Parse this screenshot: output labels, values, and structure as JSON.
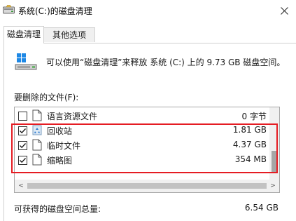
{
  "window": {
    "title": "系统(C:)的磁盘清理",
    "close_glyph": "✕"
  },
  "tabs": [
    {
      "label": "磁盘清理",
      "active": true
    },
    {
      "label": "其他选项",
      "active": false
    }
  ],
  "drive_description": "可以使用“磁盘清理”来释放 系统 (C:) 上的 9.73 GB 磁盘空间。",
  "files_to_delete_label": "要删除的文件(F):",
  "file_list": [
    {
      "name": "语言资源文件",
      "size": "0 字节",
      "checked": false,
      "icon": "file-icon"
    },
    {
      "name": "回收站",
      "size": "1.81 GB",
      "checked": true,
      "icon": "recycle-bin-icon"
    },
    {
      "name": "临时文件",
      "size": "4.37 GB",
      "checked": true,
      "icon": "file-icon"
    },
    {
      "name": "缩略图",
      "size": "354 MB",
      "checked": true,
      "icon": "file-icon"
    }
  ],
  "scroll": {
    "left_arrow": "<",
    "right_arrow": ">"
  },
  "total": {
    "label": "可获得的磁盘空间总量:",
    "value": "6.54 GB"
  },
  "colors": {
    "highlight": "#e51c23",
    "accent": "#0078d7"
  }
}
